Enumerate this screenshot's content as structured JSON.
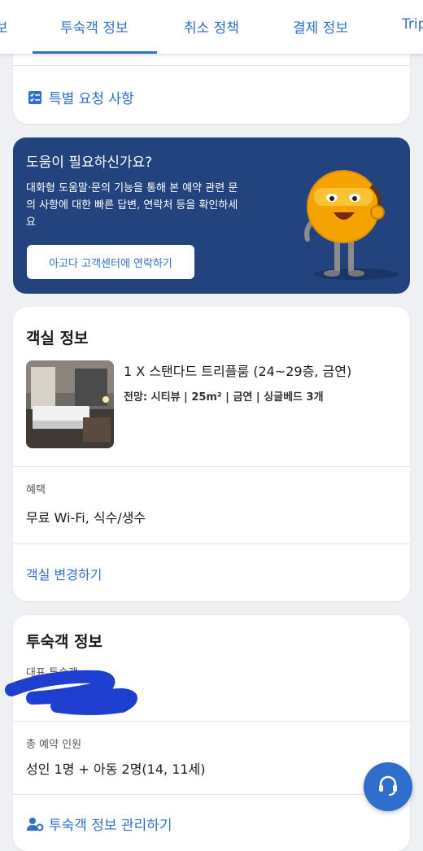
{
  "tabs": [
    {
      "label": "보"
    },
    {
      "label": "투숙객 정보"
    },
    {
      "label": "취소 정책"
    },
    {
      "label": "결제 정보"
    },
    {
      "label": "Trip"
    }
  ],
  "special_request": {
    "label": "특별 요청 사항"
  },
  "help": {
    "title": "도움이 필요하신가요?",
    "desc_lines": [
      "대화형 도움말·문의 기능을 통해 본 예약 관련 문",
      "의 사항에 대한 빠른 답변, 연락처 등을 확인하세",
      "요"
    ],
    "button": "아고다 고객센터에 연락하기"
  },
  "room": {
    "title": "객실 정보",
    "name": "1 X 스탠다드 트리플룸 (24~29층, 금연)",
    "details": "전망: 시티뷰 | 25m² | 금연 | 싱글베드 3개",
    "benefit_label": "혜택",
    "benefit_value": "무료 Wi-Fi, 식수/생수",
    "change_link": "객실 변경하기"
  },
  "guest": {
    "title": "투숙객 정보",
    "primary_label": "대표 투숙객",
    "total_label": "총 예약 인원",
    "total_value": "성인 1명 + 아동 2명(14, 11세)",
    "manage_link": "투숙객 정보 관리하기"
  },
  "colors": {
    "accent": "#2f6ecd",
    "help_bg": "#23437e",
    "page_bg": "#eef0f3",
    "redaction": "#1f3fd1"
  },
  "icons": {
    "special_request": "checklist-icon",
    "manage": "people-gear-icon",
    "fab": "headset-icon"
  }
}
